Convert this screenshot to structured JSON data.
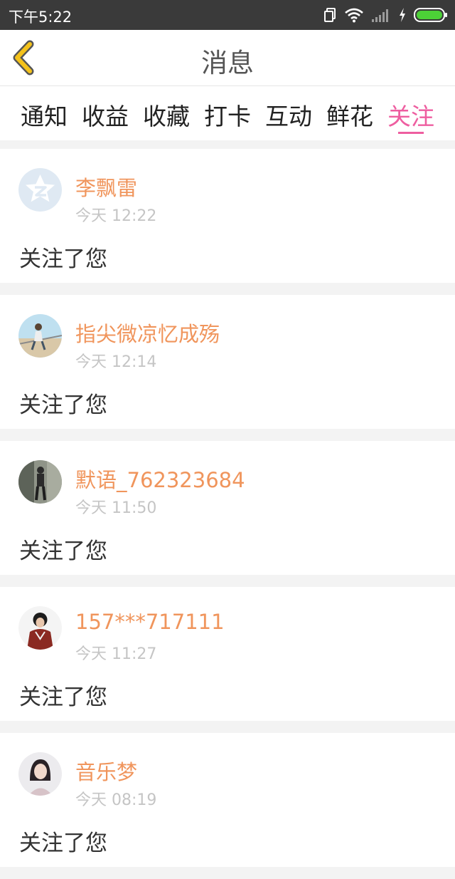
{
  "status_bar": {
    "time": "下午5:22",
    "icons": [
      "dual-sim-icon",
      "wifi-icon",
      "signal-icon",
      "charging-icon",
      "battery-icon"
    ]
  },
  "header": {
    "title": "消息",
    "back_icon": "chevron-left-icon"
  },
  "tabs": [
    {
      "label": "通知",
      "active": false
    },
    {
      "label": "收益",
      "active": false
    },
    {
      "label": "收藏",
      "active": false
    },
    {
      "label": "打卡",
      "active": false
    },
    {
      "label": "互动",
      "active": false
    },
    {
      "label": "鲜花",
      "active": false
    },
    {
      "label": "关注",
      "active": true
    }
  ],
  "messages": [
    {
      "name": "李飘雷",
      "time": "今天 12:22",
      "text": "关注了您"
    },
    {
      "name": "指尖微凉忆成殇",
      "time": "今天 12:14",
      "text": "关注了您"
    },
    {
      "name": "默语_762323684",
      "time": "今天 11:50",
      "text": "关注了您"
    },
    {
      "name": "157***717111",
      "time": "今天 11:27",
      "text": "关注了您"
    },
    {
      "name": "音乐梦",
      "time": "今天 08:19",
      "text": "关注了您"
    }
  ],
  "colors": {
    "accent_pink": "#ee5ea0",
    "username_orange": "#f0955c",
    "back_arrow_yellow": "#f4c21b",
    "status_bar_bg": "#3a3a3a",
    "battery_green": "#4cd137"
  }
}
